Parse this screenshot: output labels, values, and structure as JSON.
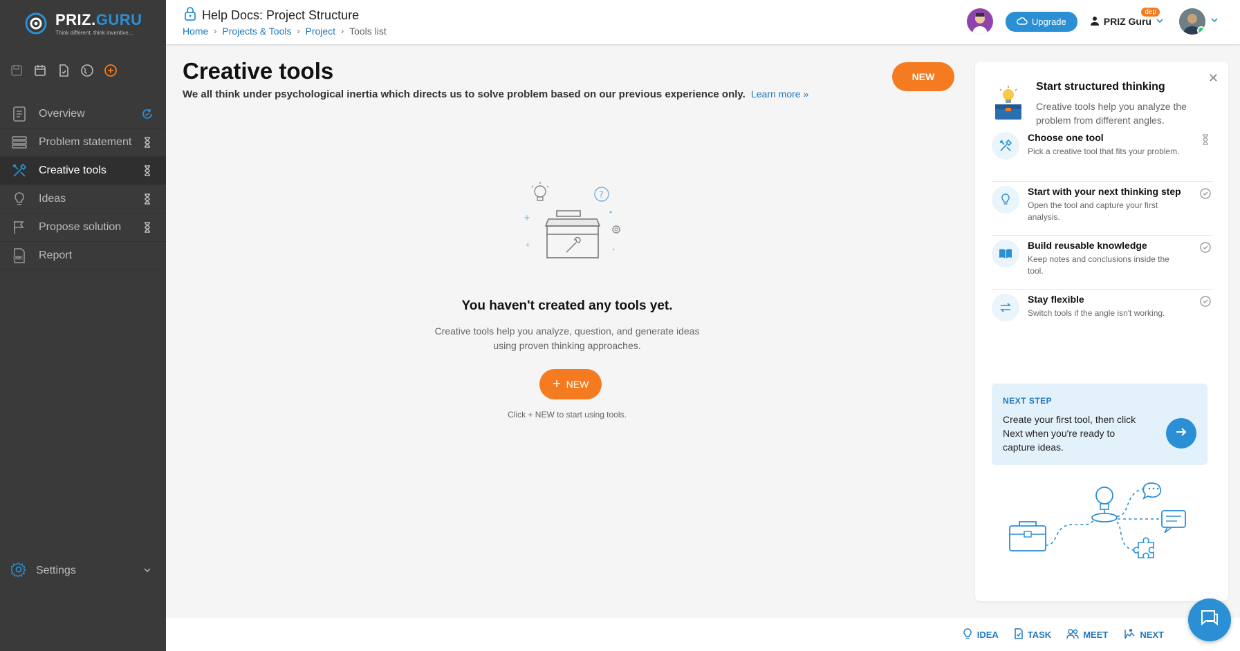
{
  "app": {
    "logo_main": "PRIZ.",
    "logo_accent": "GURU",
    "logo_tagline": "Think different, think inventive..."
  },
  "sidebar": {
    "items": [
      {
        "label": "Overview",
        "status": "in-progress-icon"
      },
      {
        "label": "Problem statement",
        "status": "hourglass-icon"
      },
      {
        "label": "Creative tools",
        "status": "hourglass-icon"
      },
      {
        "label": "Ideas",
        "status": "hourglass-icon"
      },
      {
        "label": "Propose solution",
        "status": "hourglass-icon"
      },
      {
        "label": "Report",
        "status": ""
      }
    ],
    "settings_label": "Settings"
  },
  "header": {
    "title": "Help Docs: Project Structure",
    "breadcrumbs": [
      "Home",
      "Projects & Tools",
      "Project",
      "Tools list"
    ],
    "upgrade_label": "Upgrade",
    "user_name": "PRIZ Guru",
    "user_badge": "dep"
  },
  "main": {
    "title": "Creative tools",
    "subtitle": "We all think under psychological inertia which directs us to solve problem based on our previous experience only.",
    "learn_more": "Learn more »",
    "new_label": "NEW",
    "empty_title": "You haven't created any tools yet.",
    "empty_desc": "Creative tools help you analyze, question, and generate ideas using proven thinking approaches.",
    "empty_new_label": "NEW",
    "empty_hint": "Click + NEW to start using tools."
  },
  "panel": {
    "title": "Start structured thinking",
    "subtitle": "Creative tools help you analyze the problem from different angles.",
    "steps": [
      {
        "title": "Choose one tool",
        "desc": "Pick a creative tool that fits your problem.",
        "status": "hourglass-icon"
      },
      {
        "title": "Start with your next thinking step",
        "desc": "Open the tool and capture your first analysis.",
        "status": "check-circle-icon"
      },
      {
        "title": "Build reusable knowledge",
        "desc": "Keep notes and conclusions inside the tool.",
        "status": "check-circle-icon"
      },
      {
        "title": "Stay flexible",
        "desc": "Switch tools if the angle isn't working.",
        "status": "check-circle-icon"
      }
    ],
    "next_label": "NEXT STEP",
    "next_text": "Create your first tool, then click Next when you're ready to capture ideas."
  },
  "bottom": {
    "actions": [
      "IDEA",
      "TASK",
      "MEET",
      "NEXT"
    ]
  },
  "colors": {
    "accent": "#2a8fd4",
    "orange": "#f47b20",
    "sidebar_bg": "#3a3a3a"
  }
}
